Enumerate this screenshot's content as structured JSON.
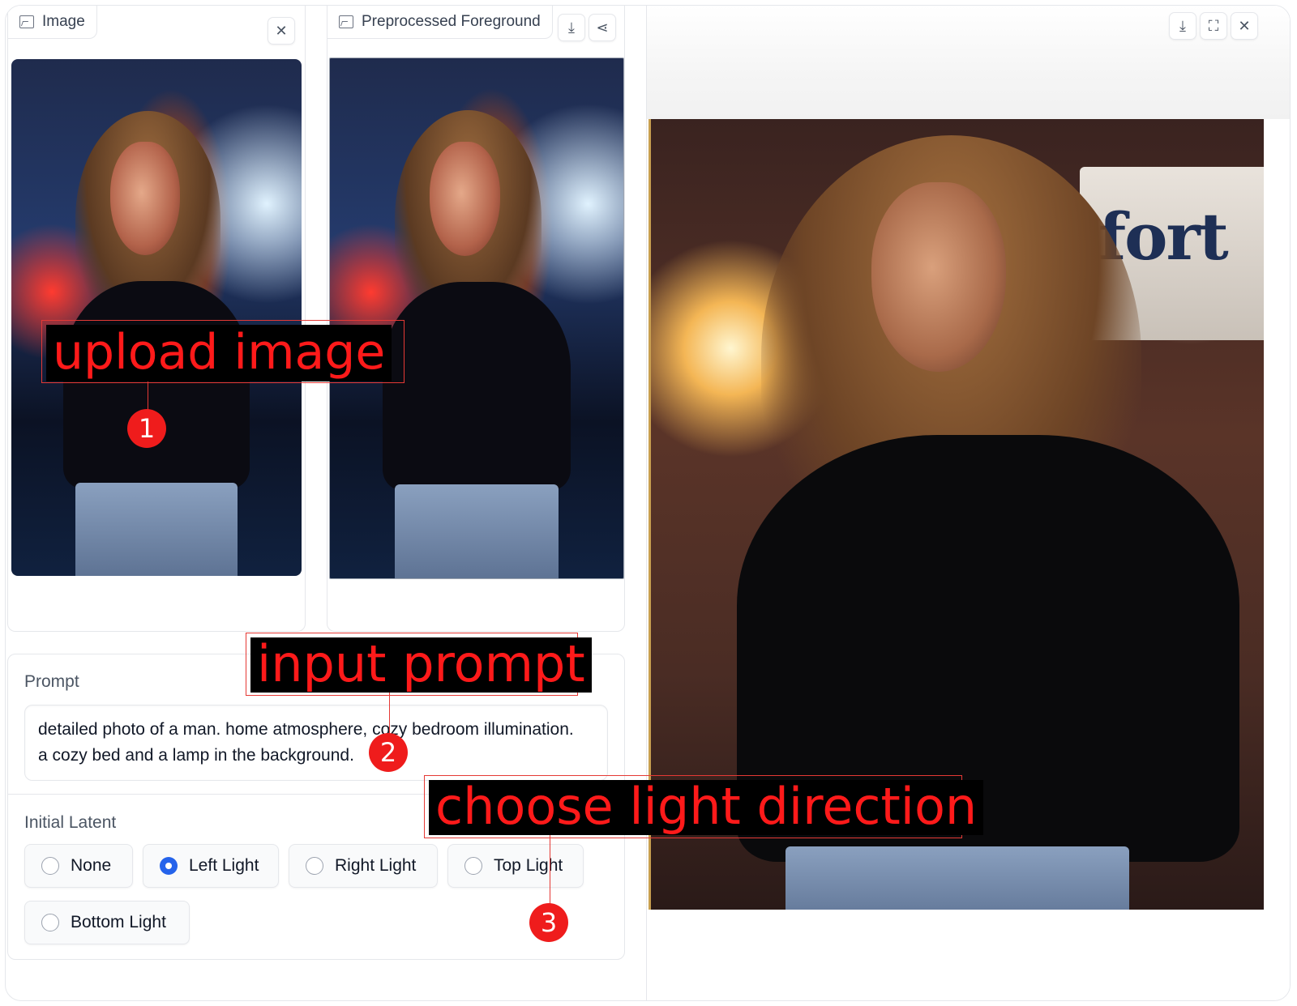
{
  "image_panel": {
    "label": "Image",
    "close_icon": "close-icon"
  },
  "preprocessed_panel": {
    "label": "Preprocessed Foreground",
    "download_icon": "download-icon",
    "share_icon": "share-icon"
  },
  "output_panel": {
    "download_icon": "download-icon",
    "fullscreen_icon": "fullscreen-icon",
    "close_icon": "close-icon",
    "sign_text": "fort"
  },
  "prompt": {
    "label": "Prompt",
    "value": "detailed photo of a man. home atmosphere, cozy bedroom illumination.\na cozy bed and a lamp in the background."
  },
  "initial_latent": {
    "label": "Initial Latent",
    "options": [
      "None",
      "Left Light",
      "Right Light",
      "Top Light",
      "Bottom Light"
    ],
    "selected": "Left Light"
  },
  "annotations": {
    "step1": {
      "text": "upload image",
      "number": "1"
    },
    "step2": {
      "text": "input prompt",
      "number": "2"
    },
    "step3": {
      "text": "choose light direction",
      "number": "3"
    }
  },
  "colors": {
    "accent": "#2563eb",
    "annotation_red": "#ff1a1a",
    "badge_red": "#ef1c1c"
  }
}
